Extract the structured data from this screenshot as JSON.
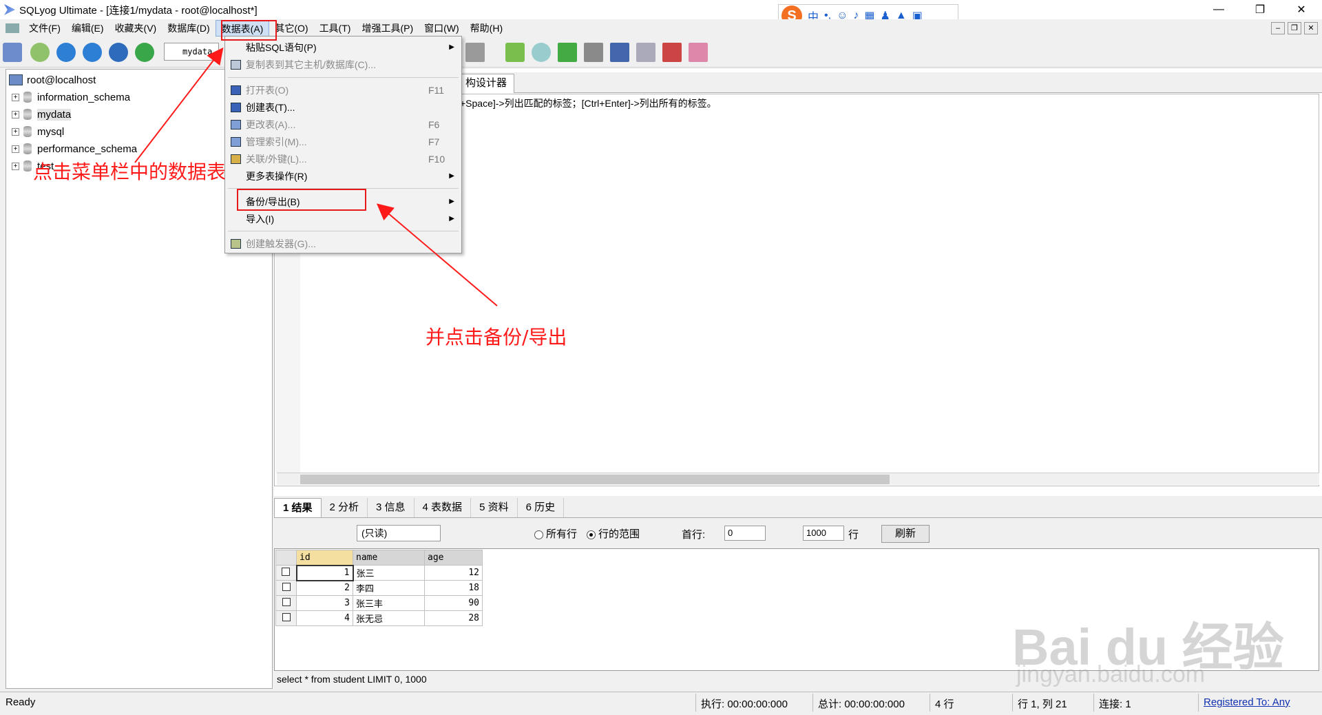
{
  "window": {
    "title": "SQLyog Ultimate - [连接1/mydata - root@localhost*]"
  },
  "menubar": {
    "items": [
      "文件(F)",
      "编辑(E)",
      "收藏夹(V)",
      "数据库(D)",
      "数据表(A)",
      "其它(O)",
      "工具(T)",
      "增强工具(P)",
      "窗口(W)",
      "帮助(H)"
    ],
    "active_index": 4
  },
  "toolbar": {
    "db_combo": "mydata"
  },
  "tree": {
    "root": "root@localhost",
    "databases": [
      "information_schema",
      "mydata",
      "mysql",
      "performance_schema",
      "test"
    ]
  },
  "editor": {
    "tab_label": "构设计器",
    "hint": "+Space]->列出匹配的标签；[Ctrl+Enter]->列出所有的标签。"
  },
  "dropdown": {
    "items": [
      {
        "label": "粘贴SQL语句(P)",
        "shortcut": "",
        "submenu": true,
        "disabled": false
      },
      {
        "label": "复制表到其它主机/数据库(C)...",
        "shortcut": "",
        "submenu": false,
        "disabled": true
      },
      {
        "label": "打开表(O)",
        "shortcut": "F11",
        "submenu": false,
        "disabled": true
      },
      {
        "label": "创建表(T)...",
        "shortcut": "",
        "submenu": false,
        "disabled": false
      },
      {
        "label": "更改表(A)...",
        "shortcut": "F6",
        "submenu": false,
        "disabled": true
      },
      {
        "label": "管理索引(M)...",
        "shortcut": "F7",
        "submenu": false,
        "disabled": true
      },
      {
        "label": "关联/外键(L)...",
        "shortcut": "F10",
        "submenu": false,
        "disabled": true
      },
      {
        "label": "更多表操作(R)",
        "shortcut": "",
        "submenu": true,
        "disabled": false
      },
      {
        "label": "备份/导出(B)",
        "shortcut": "",
        "submenu": true,
        "disabled": false
      },
      {
        "label": "导入(I)",
        "shortcut": "",
        "submenu": true,
        "disabled": false
      },
      {
        "label": "创建触发器(G)...",
        "shortcut": "",
        "submenu": false,
        "disabled": true
      }
    ]
  },
  "annotations": {
    "menu_hint": "点击菜单栏中的数据表",
    "export_hint": "并点击备份/导出"
  },
  "results": {
    "tabs": [
      "1 结果",
      "2 分析",
      "3 信息",
      "4 表数据",
      "5 资料",
      "6 历史"
    ],
    "mode": "(只读)",
    "radio_all": "所有行",
    "radio_range": "行的范围",
    "first_row_label": "首行:",
    "first_row": "0",
    "row_count": "1000",
    "rows_label": "行",
    "refresh": "刷新",
    "columns": [
      "id",
      "name",
      "age"
    ],
    "rows": [
      [
        "1",
        "张三",
        "12"
      ],
      [
        "2",
        "李四",
        "18"
      ],
      [
        "3",
        "张三丰",
        "90"
      ],
      [
        "4",
        "张无忌",
        "28"
      ]
    ],
    "sql": "select * from student  LIMIT 0, 1000"
  },
  "status": {
    "ready": "Ready",
    "exec": "执行: 00:00:00:000",
    "total": "总计: 00:00:00:000",
    "rows": "4 行",
    "pos": "行 1, 列 21",
    "conn": "连接: 1",
    "registered": "Registered To: Any"
  },
  "watermark": {
    "brand": "Bai du 经验",
    "url": "jingyan.baidu.com"
  },
  "colors": {
    "annotation": "#ff1a1a",
    "menu_highlight": "#cfe0f5"
  }
}
